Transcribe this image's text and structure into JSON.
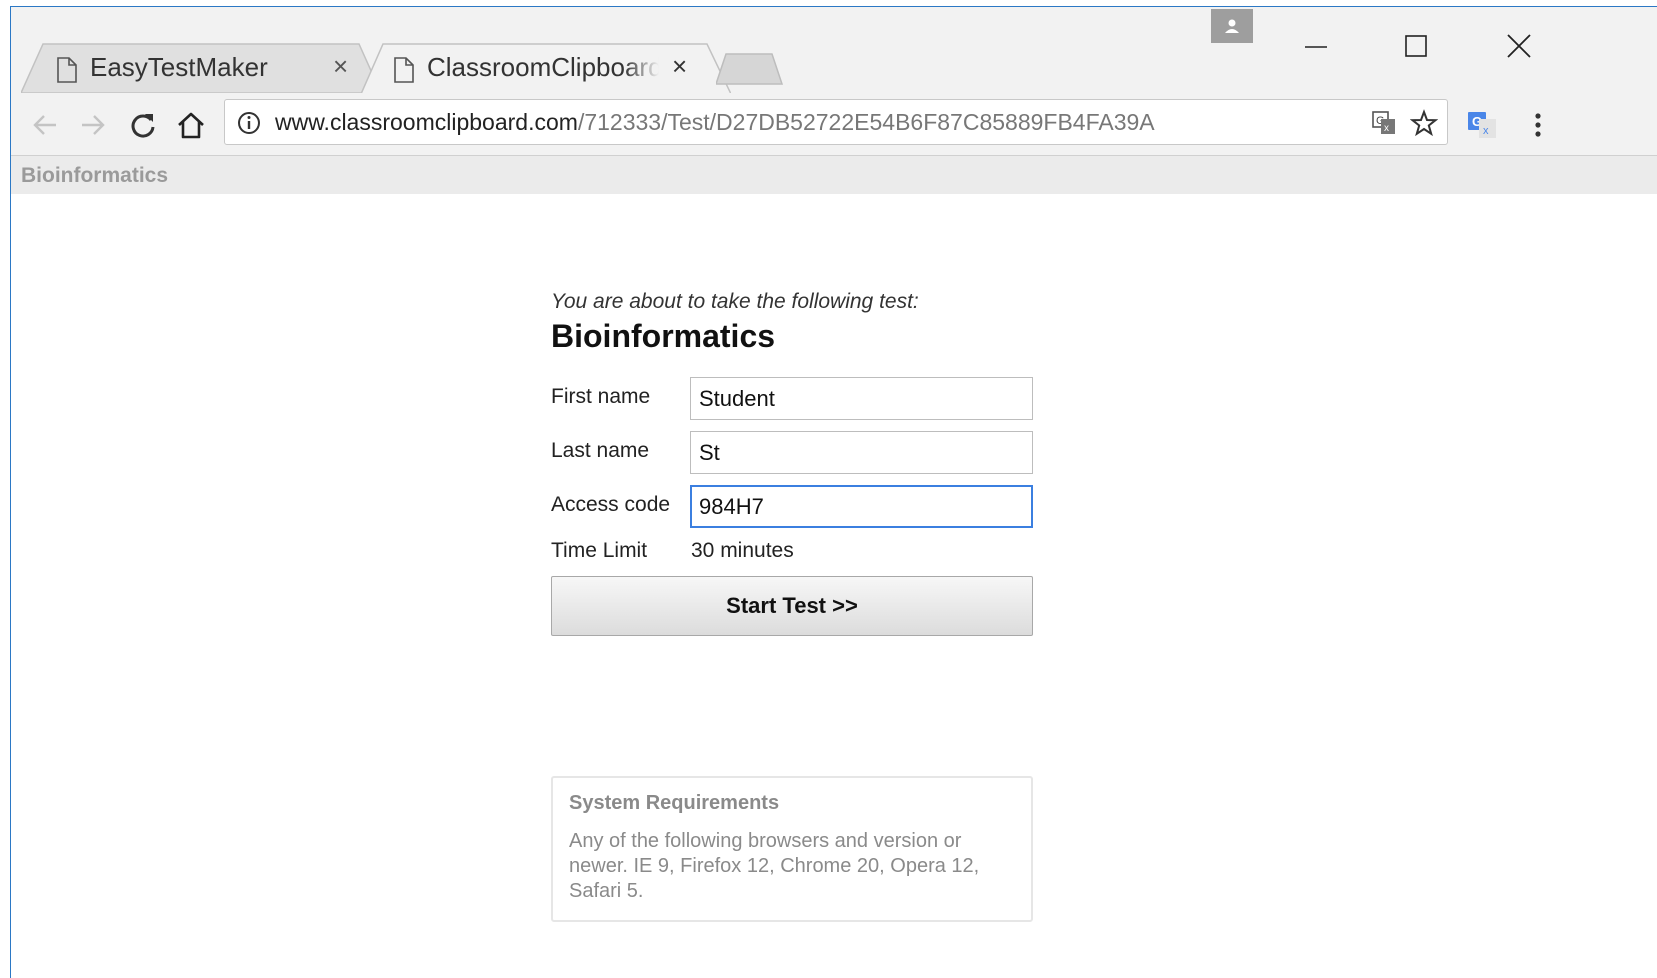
{
  "browser": {
    "tabs": [
      {
        "title": "EasyTestMaker",
        "active": false
      },
      {
        "title": "ClassroomClipboard",
        "active": true
      }
    ],
    "url_host": "www.classroomclipboard.com",
    "url_path": "/712333/Test/D27DB52722E54B6F87C85889FB4FA39A"
  },
  "page_strip": {
    "title": "Bioinformatics"
  },
  "form": {
    "intro": "You are about to take the following test:",
    "test_title": "Bioinformatics",
    "first_name_label": "First name",
    "first_name_value": "Student",
    "last_name_label": "Last name",
    "last_name_value": "St",
    "access_code_label": "Access code",
    "access_code_value": "984H7",
    "time_limit_label": "Time Limit",
    "time_limit_value": "30 minutes",
    "start_button": "Start Test >>"
  },
  "system_requirements": {
    "title": "System Requirements",
    "text": "Any of the following browsers and version or newer. IE 9, Firefox 12, Chrome 20, Opera 12, Safari 5."
  },
  "colors": {
    "focus_border": "#3b7fe0",
    "window_border": "#2b78c5"
  }
}
